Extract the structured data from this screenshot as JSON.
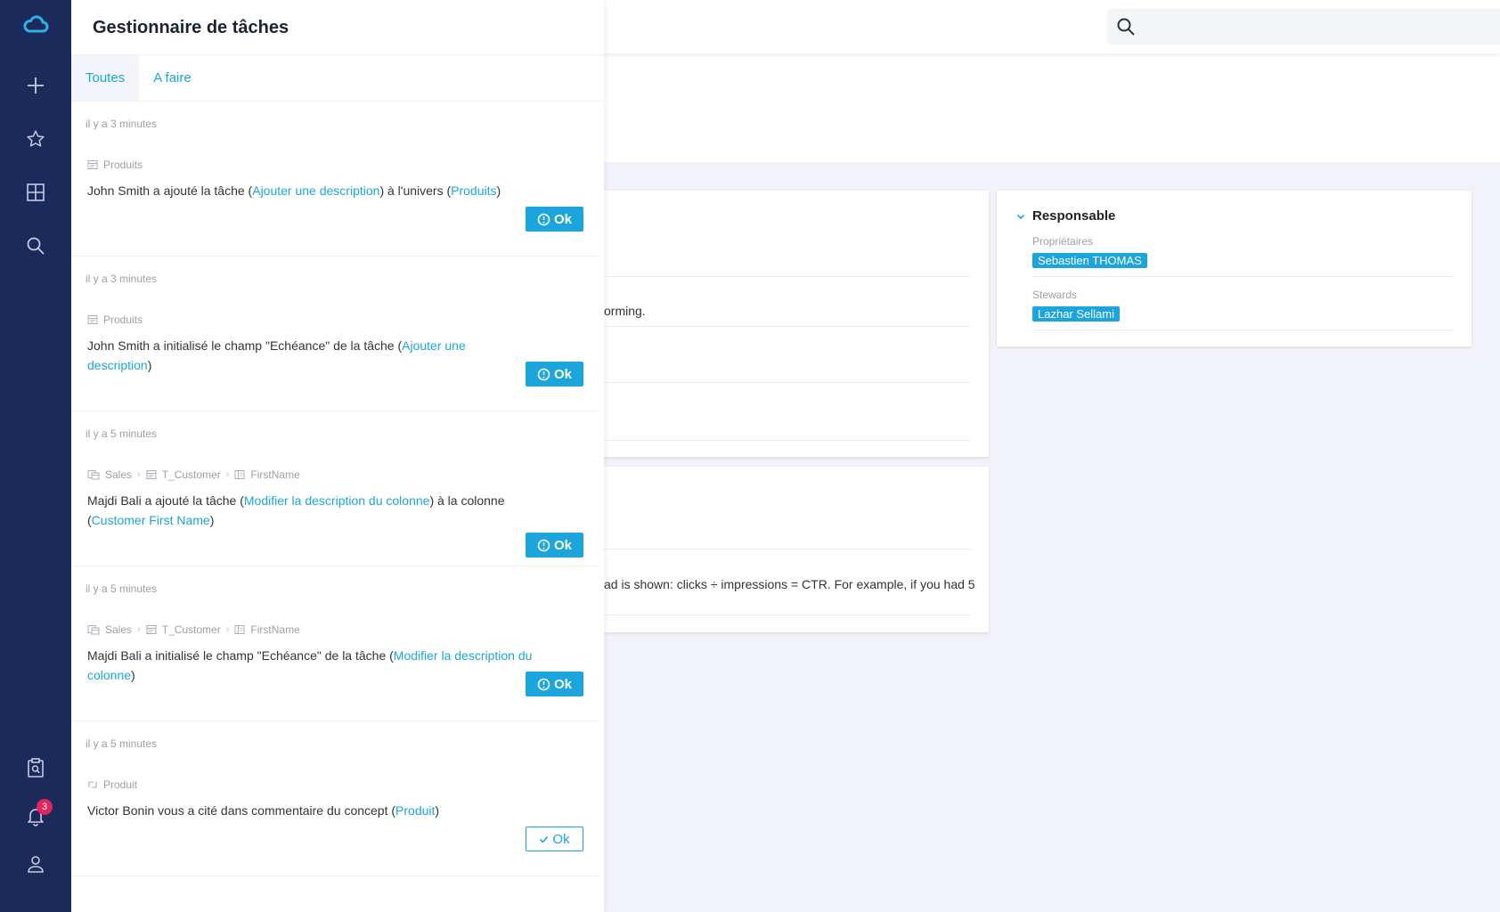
{
  "panel": {
    "title": "Gestionnaire de tâches",
    "tabs": [
      {
        "label": "Toutes",
        "active": true
      },
      {
        "label": "A faire",
        "active": false
      }
    ]
  },
  "tasks": [
    {
      "time": "il y a 3 minutes",
      "crumb": [
        {
          "icon": "table-icon",
          "label": "Produits"
        }
      ],
      "parts": [
        {
          "t": "John Smith a ajouté la tâche ("
        },
        {
          "t": "Ajouter une description",
          "link": true
        },
        {
          "t": ") à l'univers ("
        },
        {
          "t": "Produits",
          "link": true
        },
        {
          "t": ")"
        }
      ],
      "button": "Ok",
      "done": false
    },
    {
      "time": "il y a 3 minutes",
      "crumb": [
        {
          "icon": "table-icon",
          "label": "Produits"
        }
      ],
      "parts": [
        {
          "t": "John Smith a initialisé le champ \"Echéance\" de la tâche ("
        },
        {
          "t": "Ajouter une description",
          "link": true
        },
        {
          "t": ")"
        }
      ],
      "button": "Ok",
      "done": false
    },
    {
      "time": "il y a 5 minutes",
      "crumb": [
        {
          "icon": "database-icon",
          "label": "Sales"
        },
        {
          "icon": "table-icon",
          "label": "T_Customer"
        },
        {
          "icon": "column-icon",
          "label": "FirstName"
        }
      ],
      "parts": [
        {
          "t": "Majdi Bali a ajouté la tâche ("
        },
        {
          "t": "Modifier la description du colonne",
          "link": true
        },
        {
          "t": ") à la colonne ("
        },
        {
          "t": "Customer First Name",
          "link": true
        },
        {
          "t": ")"
        }
      ],
      "button": "Ok",
      "done": false
    },
    {
      "time": "il y a 5 minutes",
      "crumb": [
        {
          "icon": "database-icon",
          "label": "Sales"
        },
        {
          "icon": "table-icon",
          "label": "T_Customer"
        },
        {
          "icon": "column-icon",
          "label": "FirstName"
        }
      ],
      "parts": [
        {
          "t": "Majdi Bali a initialisé le champ \"Echéance\" de la tâche ("
        },
        {
          "t": "Modifier la description du colonne",
          "link": true
        },
        {
          "t": ")"
        }
      ],
      "button": "Ok",
      "done": false
    },
    {
      "time": "il y a 5 minutes",
      "crumb": [
        {
          "icon": "concept-icon",
          "label": "Produit"
        }
      ],
      "parts": [
        {
          "t": "Victor Bonin vous a cité dans commentaire du concept ("
        },
        {
          "t": "Produit",
          "link": true
        },
        {
          "t": ")"
        }
      ],
      "button": "Ok",
      "done": true
    }
  ],
  "background": {
    "card1_text": "orming.",
    "card2_text": "ad is shown: clicks ÷ impressions = CTR. For example, if you had 5",
    "responsable": {
      "title": "Responsable",
      "owners_label": "Propriétaires",
      "owner": "Sebastien THOMAS",
      "stewards_label": "Stewards",
      "steward": "Lazhar Sellami"
    }
  },
  "rail": {
    "notification_count": "3",
    "icons": [
      "cloud-logo-icon",
      "plus-icon",
      "star-icon",
      "grid-icon",
      "search-icon",
      "clipboard-search-icon",
      "bell-icon",
      "user-icon"
    ]
  },
  "colors": {
    "rail": "#1b2a5a",
    "accent": "#1ba5dc",
    "badge": "#e2245c"
  }
}
